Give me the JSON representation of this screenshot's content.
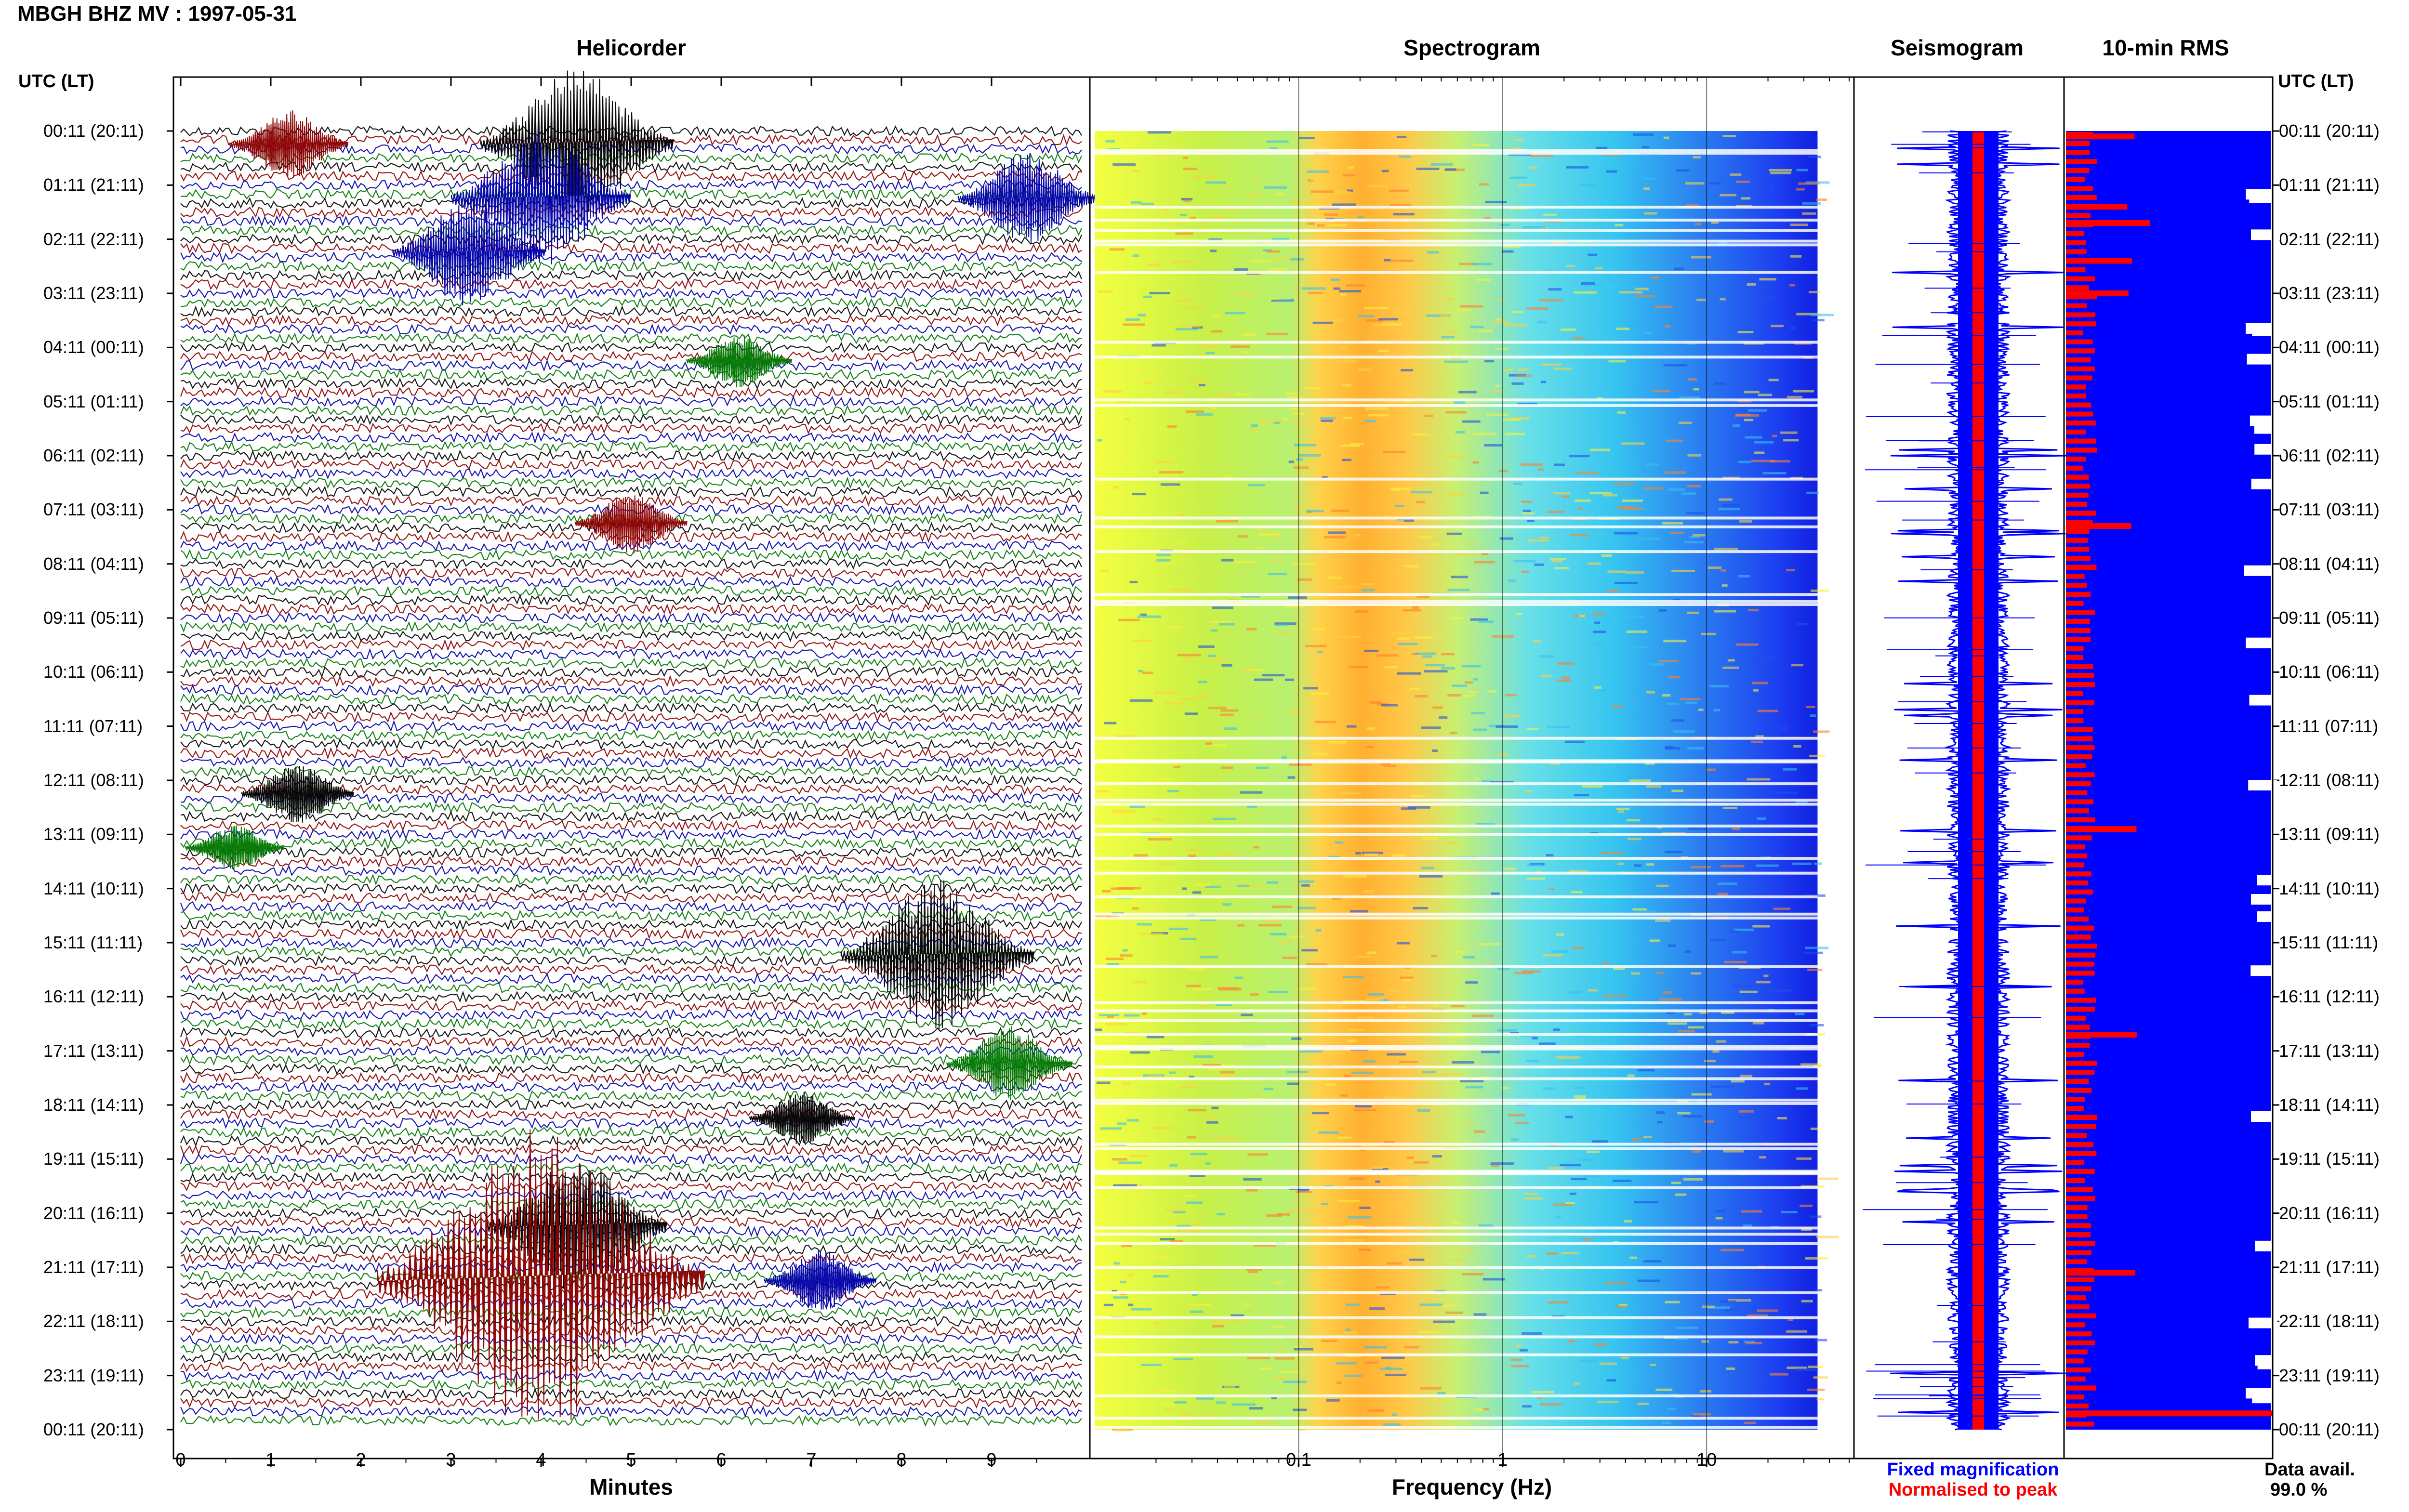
{
  "title": "MBGH BHZ MV : 1997-05-31",
  "panels": {
    "helicorder": "Helicorder",
    "spectrogram": "Spectrogram",
    "seismogram": "Seismogram",
    "rms": "10-min RMS"
  },
  "time_axis_header": "UTC (LT)",
  "time_labels": [
    "00:11 (20:11)",
    "01:11 (21:11)",
    "02:11 (22:11)",
    "03:11 (23:11)",
    "04:11 (00:11)",
    "05:11 (01:11)",
    "06:11 (02:11)",
    "07:11 (03:11)",
    "08:11 (04:11)",
    "09:11 (05:11)",
    "10:11 (06:11)",
    "11:11 (07:11)",
    "12:11 (08:11)",
    "13:11 (09:11)",
    "14:11 (10:11)",
    "15:11 (11:11)",
    "16:11 (12:11)",
    "17:11 (13:11)",
    "18:11 (14:11)",
    "19:11 (15:11)",
    "20:11 (16:11)",
    "21:11 (17:11)",
    "22:11 (18:11)",
    "23:11 (19:11)",
    "00:11 (20:11)"
  ],
  "legend": {
    "fixed": "Fixed magnification",
    "normalised": "Normalised to peak",
    "fixed_color": "#0000ff",
    "normalised_color": "#ff0000"
  },
  "data_avail": {
    "label": "Data avail.",
    "value": "99.0 %"
  },
  "chart_data": [
    {
      "type": "line",
      "panel": "Helicorder",
      "xlabel": "Minutes",
      "x_ticks": [
        "0",
        "1",
        "2",
        "3",
        "4",
        "5",
        "6",
        "7",
        "8",
        "9"
      ],
      "xlim": [
        0,
        10
      ],
      "rows": 144,
      "trace_colors": [
        "#000000",
        "#8b0000",
        "#0000aa",
        "#007700"
      ],
      "events": [
        {
          "hour": 0,
          "minute": 4.4,
          "amp": 1.0,
          "color": "#000000"
        },
        {
          "hour": 1,
          "minute": 4.0,
          "amp": 0.9,
          "color": "#0000aa"
        },
        {
          "hour": 1,
          "minute": 9.4,
          "amp": 0.6,
          "color": "#0000aa"
        },
        {
          "hour": 2,
          "minute": 3.2,
          "amp": 0.7,
          "color": "#0000aa"
        },
        {
          "hour": 0,
          "minute": 1.2,
          "amp": 0.45,
          "color": "#8b0000"
        },
        {
          "hour": 4,
          "minute": 6.2,
          "amp": 0.35,
          "color": "#007700"
        },
        {
          "hour": 7,
          "minute": 5.0,
          "amp": 0.4,
          "color": "#8b0000"
        },
        {
          "hour": 12,
          "minute": 1.3,
          "amp": 0.4,
          "color": "#000000"
        },
        {
          "hour": 13,
          "minute": 0.6,
          "amp": 0.3,
          "color": "#007700"
        },
        {
          "hour": 15,
          "minute": 8.4,
          "amp": 1.0,
          "color": "#000000"
        },
        {
          "hour": 17,
          "minute": 9.2,
          "amp": 0.5,
          "color": "#007700"
        },
        {
          "hour": 18,
          "minute": 6.9,
          "amp": 0.35,
          "color": "#000000"
        },
        {
          "hour": 20,
          "minute": 4.4,
          "amp": 0.9,
          "color": "#000000"
        },
        {
          "hour": 21,
          "minute": 4.0,
          "amp": 2.0,
          "color": "#8b0000"
        },
        {
          "hour": 21,
          "minute": 7.1,
          "amp": 0.4,
          "color": "#0000aa"
        }
      ]
    },
    {
      "type": "heatmap",
      "panel": "Spectrogram",
      "xlabel": "Frequency (Hz)",
      "x_scale": "log",
      "x_ticks": [
        "0.1",
        "1",
        "10"
      ],
      "xlim": [
        0.01,
        50
      ],
      "fmax": 35,
      "peak_band_hz": [
        0.2,
        0.8
      ]
    },
    {
      "type": "line",
      "panel": "Seismogram",
      "series": [
        {
          "name": "Fixed magnification",
          "color": "#0000ff"
        },
        {
          "name": "Normalised to peak",
          "color": "#ff0000"
        }
      ]
    },
    {
      "type": "bar",
      "panel": "10-min RMS",
      "series_colors": [
        "#0000ff",
        "#ff0000"
      ],
      "rms_peak_hours": [
        0.1,
        1.4,
        1.7,
        2.4,
        3.0,
        7.3,
        12.9,
        16.7,
        21.1,
        23.7
      ]
    }
  ]
}
